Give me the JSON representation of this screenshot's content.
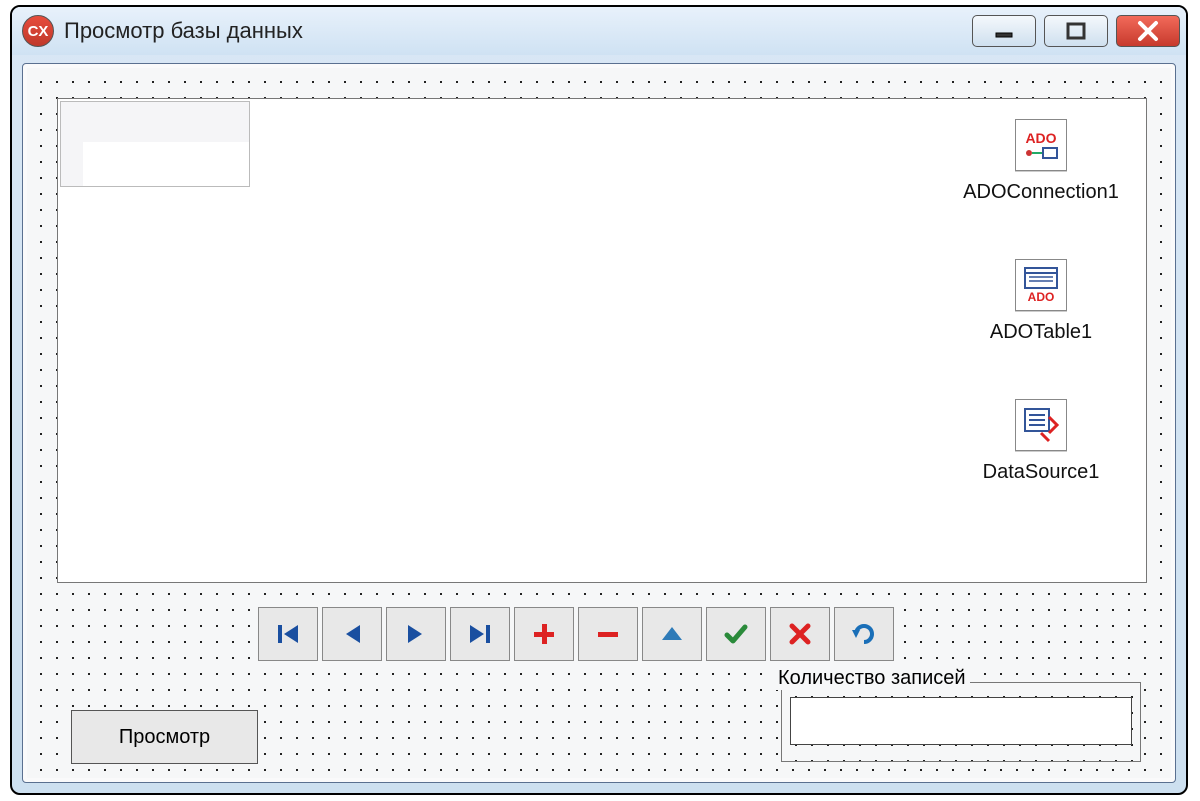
{
  "window": {
    "title": "Просмотр базы данных",
    "app_icon_text": "CX"
  },
  "components": {
    "ado_connection": {
      "label": "ADOConnection1",
      "icon_text": "ADO"
    },
    "ado_table": {
      "label": "ADOTable1",
      "icon_text": "ADO"
    },
    "data_source": {
      "label": "DataSource1"
    }
  },
  "navigator": {
    "first": "first",
    "prior": "prior",
    "next": "next",
    "last": "last",
    "insert": "insert",
    "delete": "delete",
    "edit": "edit",
    "post": "post",
    "cancel": "cancel",
    "refresh": "refresh"
  },
  "groupbox": {
    "caption": "Количество записей",
    "value": ""
  },
  "buttons": {
    "view": "Просмотр"
  }
}
